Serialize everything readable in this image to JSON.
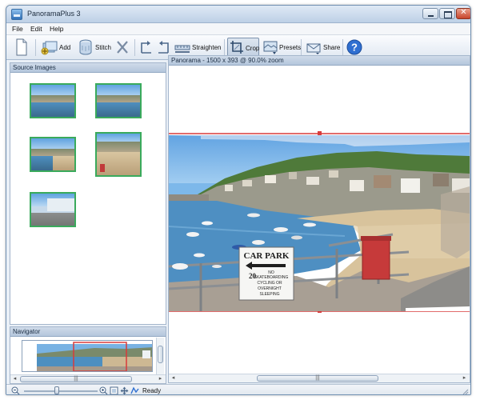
{
  "window": {
    "title": "PanoramaPlus 3",
    "close_glyph": "✕"
  },
  "menu": [
    "File",
    "Edit",
    "Help"
  ],
  "toolbar": {
    "add": "Add",
    "stitch": "Stitch",
    "straighten": "Straighten",
    "crop": "Crop",
    "presets": "Presets",
    "share": "Share",
    "icons": [
      "new-document-icon",
      "add-images-icon",
      "stitch-icon",
      "delete-icon",
      "rotate-left-icon",
      "rotate-right-icon",
      "straighten-icon",
      "crop-icon",
      "presets-icon",
      "share-icon",
      "help-icon"
    ]
  },
  "source_panel": {
    "title": "Source Images",
    "thumbnail_count": 5
  },
  "navigator": {
    "title": "Navigator"
  },
  "main": {
    "title": "Panorama - 1500 x 393 @ 90.0% zoom"
  },
  "sign": {
    "title": "CAR PARK",
    "line1": "NO",
    "line2": "SKATEBOARDING",
    "line3": "CYCLING OR",
    "line4": "OVERNIGHT",
    "line5": "SLEEPING",
    "number": "20"
  },
  "scrollbar": {
    "grip": "|||"
  },
  "status": {
    "text": "Ready"
  },
  "colors": {
    "accent": "#3aaa5c",
    "crop_line": "#d83b3b",
    "help": "#2f6fd1"
  }
}
